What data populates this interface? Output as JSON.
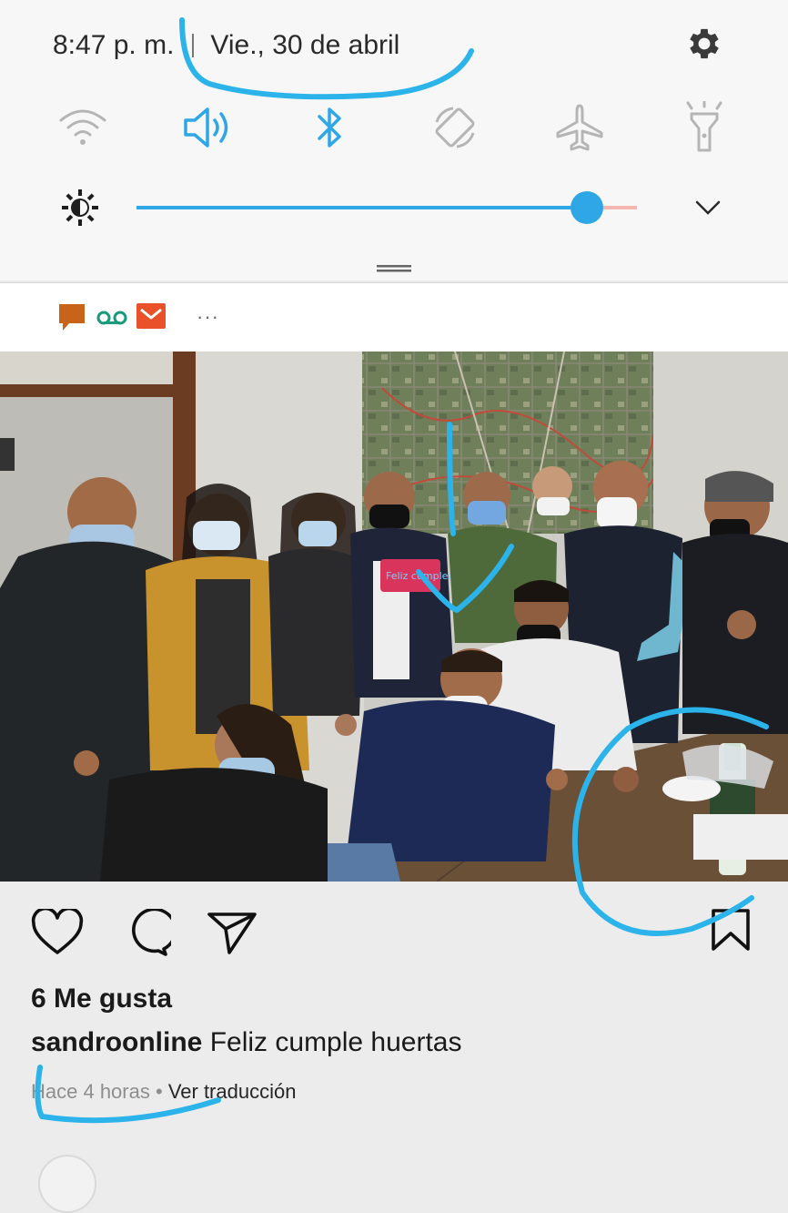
{
  "status_bar": {
    "time": "8:47 p. m.",
    "date": "Vie., 30 de abril"
  },
  "quick_settings": {
    "tiles": [
      {
        "icon": "wifi-icon",
        "active": false
      },
      {
        "icon": "sound-icon",
        "active": true
      },
      {
        "icon": "bluetooth-icon",
        "active": true
      },
      {
        "icon": "auto-rotate-icon",
        "active": false
      },
      {
        "icon": "airplane-mode-icon",
        "active": false
      },
      {
        "icon": "flashlight-icon",
        "active": false
      }
    ],
    "brightness_level": 0.9
  },
  "notifications": {
    "icons": [
      "message-icon",
      "voicemail-icon",
      "email-icon",
      "more-icon"
    ],
    "more": "···"
  },
  "post": {
    "photo_banner": "Feliz cumpleaños",
    "likes": "6 Me gusta",
    "username": "sandroonline",
    "caption": "Feliz cumple huertas",
    "time_ago": "Hace 4 horas",
    "dot": "•",
    "translate": "Ver traducción"
  },
  "colors": {
    "accent": "#2fa7e6",
    "inactive_icon": "#b5b5b5",
    "scribble": "#2bb3ea",
    "message_icon": "#c8641a",
    "voicemail_icon": "#1a9a7a",
    "email_icon": "#e8512a"
  }
}
